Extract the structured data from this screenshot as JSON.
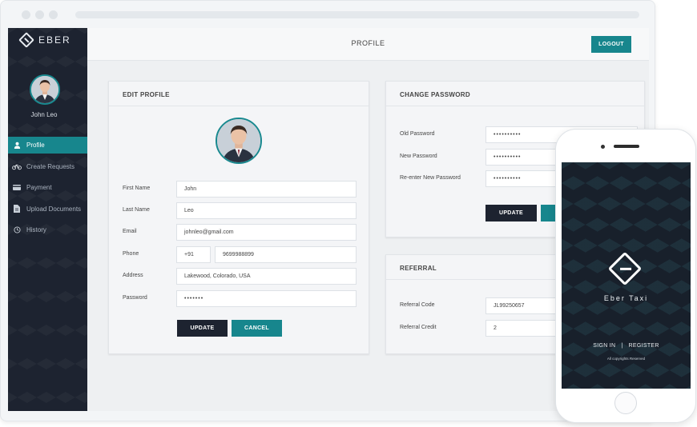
{
  "app": {
    "brand": "EBER"
  },
  "sidebar": {
    "user_name": "John Leo",
    "items": [
      {
        "label": "Profile",
        "icon": "user-icon",
        "active": true
      },
      {
        "label": "Create Requests",
        "icon": "bicycle-icon"
      },
      {
        "label": "Payment",
        "icon": "credit-card-icon"
      },
      {
        "label": "Upload Documents",
        "icon": "document-icon"
      },
      {
        "label": "History",
        "icon": "history-icon"
      }
    ]
  },
  "header": {
    "title": "PROFILE",
    "logout_label": "LOGOUT"
  },
  "edit_profile": {
    "title": "EDIT PROFILE",
    "fields": {
      "first_name": {
        "label": "First Name",
        "value": "John"
      },
      "last_name": {
        "label": "Last Name",
        "value": "Leo"
      },
      "email": {
        "label": "Email",
        "value": "johnleo@gmail.com"
      },
      "phone": {
        "label": "Phone",
        "code": "+91",
        "value": "9699988899"
      },
      "address": {
        "label": "Address",
        "value": "Lakewood, Colorado, USA"
      },
      "password": {
        "label": "Password",
        "value": "•••••••"
      }
    },
    "update_label": "UPDATE",
    "cancel_label": "CANCEL"
  },
  "change_password": {
    "title": "CHANGE PASSWORD",
    "old_label": "Old Password",
    "old_value": "••••••••••",
    "new_label": "New Password",
    "new_value": "••••••••••",
    "reenter_label": "Re-enter New Password",
    "reenter_value": "••••••••••",
    "update_label": "UPDATE"
  },
  "referral": {
    "title": "REFERRAL",
    "code_label": "Referral Code",
    "code_value": "JL99250657",
    "credit_label": "Referral Credit",
    "credit_value": "2"
  },
  "phone_app": {
    "title": "Eber Taxi",
    "sign_in": "SIGN IN",
    "separator": "|",
    "register": "REGISTER",
    "copyright": "All copyrights Reserved"
  },
  "colors": {
    "accent": "#17868d",
    "dark": "#1d2330"
  }
}
